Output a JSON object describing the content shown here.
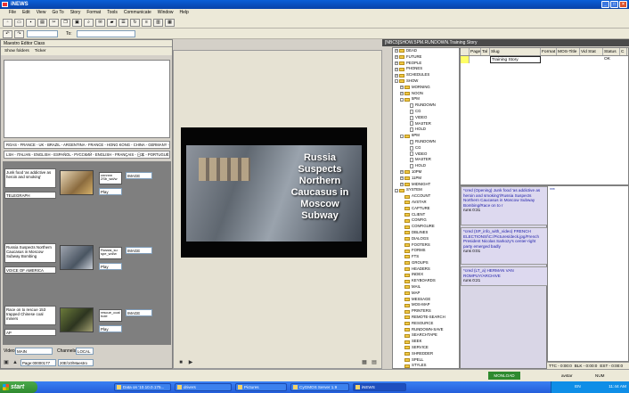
{
  "window": {
    "title": "iNEWS"
  },
  "menu": [
    "File",
    "Edit",
    "View",
    "Go To",
    "Story",
    "Format",
    "Tools",
    "Communicate",
    "Window",
    "Help"
  ],
  "toolbar2": {
    "to_label": "To:"
  },
  "maestro": {
    "title": "Maestro Editor Class",
    "tabs": [
      "Show folders",
      "Ticker"
    ],
    "ticker1": "ROAS - FRANCE - UK - BRAZIL - ARGENTINA - FRANCE - HONG KONG - CHINA - GERMANY - SPAIN",
    "ticker2": "LSH - ITALIAN - ENGLISH - ESPAÑOL - РУССКИЙ - ENGLISH - FRANÇAIS - 日本 - PORTUGUÊS - 한국어",
    "stories": [
      {
        "text": "Junk food 'as addictive as heroin and smoking'",
        "source": "TELEGRAPH",
        "chip": "cnnnnn 2Sb_wd/w",
        "action": "Play",
        "type": "IMAGE"
      },
      {
        "text": "Russia Suspects Northern Caucasus in Moscow Subway Bombing",
        "source": "VOICE OF AMERICA",
        "chip": "Russia_su spe_wd/w",
        "action": "Play",
        "type": "IMAGE"
      },
      {
        "text": "Race on to rescue 153 trapped Chinese coal miners",
        "source": "AP",
        "chip": "rescue_coal hole",
        "action": "Play",
        "type": "IMAGE"
      }
    ],
    "bottom": {
      "video_label": "Video:",
      "video_value": "MAIN",
      "channels_label": "Channels:",
      "channels_value": "LOCAL",
      "page_value": "Page:00000177",
      "path_value": "20E/10/Maestro"
    }
  },
  "preview": {
    "headline": "Russia Suspects Northern Caucasus in Moscow Subway"
  },
  "queue_path": "[NBC5]SHOW.5PM.RUNDOWN.Training Story",
  "tree": [
    {
      "label": "DEAD",
      "level": 0,
      "pm": "+"
    },
    {
      "label": "FUTURE",
      "level": 0,
      "pm": "+"
    },
    {
      "label": "PEOPLE",
      "level": 0,
      "pm": "+"
    },
    {
      "label": "PHONES",
      "level": 0,
      "pm": "+"
    },
    {
      "label": "SCHEDULES",
      "level": 0,
      "pm": "+"
    },
    {
      "label": "SHOW",
      "level": 0,
      "pm": "-"
    },
    {
      "label": "MORNING",
      "level": 1,
      "pm": "+"
    },
    {
      "label": "NOON",
      "level": 1,
      "pm": "+"
    },
    {
      "label": "5PM",
      "level": 1,
      "pm": "-"
    },
    {
      "label": "RUNDOWN",
      "level": 2,
      "pm": ""
    },
    {
      "label": "CG",
      "level": 2,
      "pm": ""
    },
    {
      "label": "VIDEO",
      "level": 2,
      "pm": ""
    },
    {
      "label": "MASTER",
      "level": 2,
      "pm": ""
    },
    {
      "label": "HOLD",
      "level": 2,
      "pm": ""
    },
    {
      "label": "6PM",
      "level": 1,
      "pm": "-"
    },
    {
      "label": "RUNDOWN",
      "level": 2,
      "pm": ""
    },
    {
      "label": "CG",
      "level": 2,
      "pm": ""
    },
    {
      "label": "VIDEO",
      "level": 2,
      "pm": ""
    },
    {
      "label": "MASTER",
      "level": 2,
      "pm": ""
    },
    {
      "label": "HOLD",
      "level": 2,
      "pm": ""
    },
    {
      "label": "10PM",
      "level": 1,
      "pm": "+"
    },
    {
      "label": "11PM",
      "level": 1,
      "pm": "+"
    },
    {
      "label": "MIDNIGHT",
      "level": 1,
      "pm": "+"
    },
    {
      "label": "SYSTEM",
      "level": 0,
      "pm": "-"
    },
    {
      "label": "ACCOUNT",
      "level": 1,
      "pm": ""
    },
    {
      "label": "AVSTAR",
      "level": 1,
      "pm": ""
    },
    {
      "label": "CAPTURE",
      "level": 1,
      "pm": ""
    },
    {
      "label": "CLIENT",
      "level": 1,
      "pm": ""
    },
    {
      "label": "CONFIG",
      "level": 1,
      "pm": ""
    },
    {
      "label": "CONFIGURE",
      "level": 1,
      "pm": ""
    },
    {
      "label": "DBLINES",
      "level": 1,
      "pm": ""
    },
    {
      "label": "DIALOGS",
      "level": 1,
      "pm": ""
    },
    {
      "label": "FOOTERS",
      "level": 1,
      "pm": ""
    },
    {
      "label": "FORMS",
      "level": 1,
      "pm": ""
    },
    {
      "label": "FTS",
      "level": 1,
      "pm": ""
    },
    {
      "label": "GROUPS",
      "level": 1,
      "pm": ""
    },
    {
      "label": "HEADERS",
      "level": 1,
      "pm": ""
    },
    {
      "label": "INDEX",
      "level": 1,
      "pm": ""
    },
    {
      "label": "KEYBOARDS",
      "level": 1,
      "pm": ""
    },
    {
      "label": "MAIL",
      "level": 1,
      "pm": ""
    },
    {
      "label": "MAP",
      "level": 1,
      "pm": ""
    },
    {
      "label": "MESSAGE",
      "level": 1,
      "pm": ""
    },
    {
      "label": "MOS-MAP",
      "level": 1,
      "pm": ""
    },
    {
      "label": "PRINTERS",
      "level": 1,
      "pm": ""
    },
    {
      "label": "REMOTE-SEARCH",
      "level": 1,
      "pm": ""
    },
    {
      "label": "RESOURCE",
      "level": 1,
      "pm": ""
    },
    {
      "label": "RUNDOWN-SAVE",
      "level": 1,
      "pm": ""
    },
    {
      "label": "SEARCHTAPE",
      "level": 1,
      "pm": ""
    },
    {
      "label": "SEEK",
      "level": 1,
      "pm": ""
    },
    {
      "label": "SERVICE",
      "level": 1,
      "pm": ""
    },
    {
      "label": "SHREDDER",
      "level": 1,
      "pm": ""
    },
    {
      "label": "SPELL",
      "level": 1,
      "pm": ""
    },
    {
      "label": "STYLES",
      "level": 1,
      "pm": ""
    },
    {
      "label": "TITLE-ENTRY",
      "level": 1,
      "pm": ""
    }
  ],
  "rundown": {
    "columns": [
      "Page",
      "Tal",
      "Slug",
      "Format",
      "MOS-Title",
      "Vid Stat",
      "Status",
      "C"
    ],
    "rows": [
      {
        "page": "",
        "tal": "",
        "slug": "Training Story",
        "format": "",
        "mos": "",
        "vid": "",
        "status": "OK",
        "c": ""
      }
    ]
  },
  "notes": [
    {
      "text": "*cred (Opening) Junk food 'as addictive as heroin and smoking'/Russia Suspects Northern Caucasus in Moscow Subway Bombing/Race on to r",
      "runs": "runs 0:31"
    },
    {
      "text": "*cred (SP_info_with_video) FRENCH ELECTIONS/\\C:/Pictures/deck.jpg/French President Nicolas Sarkozy's center-right party emerged badly",
      "runs": "runs 0:01"
    },
    {
      "text": "*cred (LT_a) HERMAN VAN ROMPUY/ARCHIVE",
      "runs": "runs 0:21"
    }
  ],
  "script_text": "***",
  "status": {
    "ttc": "TTC - 0:00:0",
    "blk": "BLK - 0:00:0",
    "est": "EST - 0:00:0",
    "monload": "MONLOAD",
    "user": "avstar",
    "num": "NUM"
  },
  "taskbar": {
    "start": "start",
    "tasks": [
      "Data on '10.10.0.175...",
      "drivers",
      "Pictures",
      "CyGMOS Server 1.9",
      "iNEWS"
    ],
    "clock": "11:44 AM",
    "lang": "EN"
  }
}
